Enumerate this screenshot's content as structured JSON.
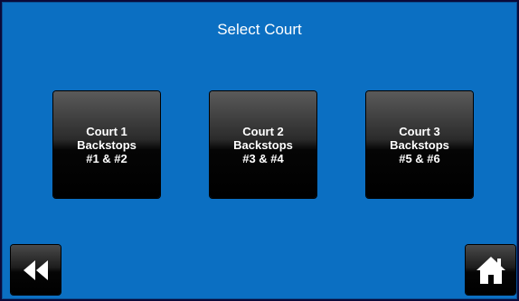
{
  "header": {
    "title": "Select Court"
  },
  "courts": [
    {
      "line1": "Court 1",
      "line2": "Backstops",
      "line3": "#1 & #2"
    },
    {
      "line1": "Court 2",
      "line2": "Backstops",
      "line3": "#3 & #4"
    },
    {
      "line1": "Court 3",
      "line2": "Backstops",
      "line3": "#5 & #6"
    }
  ],
  "nav": {
    "back_icon": "rewind-icon",
    "home_icon": "home-icon"
  },
  "colors": {
    "background": "#0b6fc2",
    "button": "#000000",
    "text": "#ffffff"
  }
}
